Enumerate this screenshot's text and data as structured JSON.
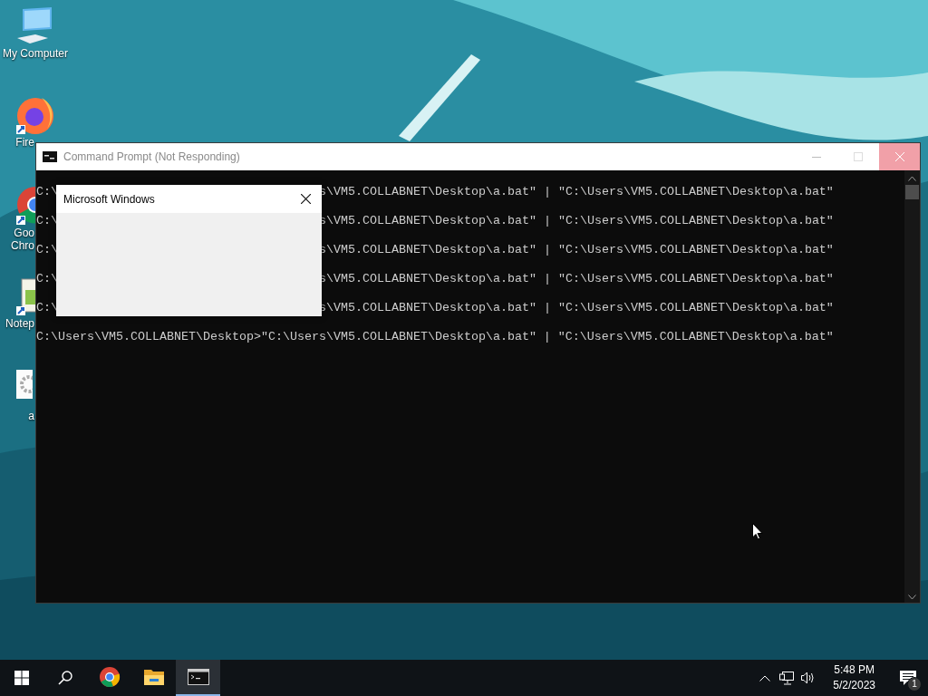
{
  "desktop": {
    "icons": [
      {
        "kind": "computer",
        "lines": [
          "My Computer"
        ]
      },
      {
        "kind": "firefox",
        "lines": [
          "Fire"
        ]
      },
      {
        "kind": "chrome",
        "lines": [
          "Goo",
          "Chro"
        ]
      },
      {
        "kind": "notepad",
        "lines": [
          "Notep"
        ]
      },
      {
        "kind": "gearfile",
        "lines": [
          "a"
        ]
      }
    ]
  },
  "window": {
    "title": "Command Prompt (Not Responding)",
    "responding": false,
    "lines": [
      {
        "left": "C:\\",
        "right": "s\\VM5.COLLABNET\\Desktop\\a.bat\" | \"C:\\Users\\VM5.COLLABNET\\Desktop\\a.bat\""
      },
      {
        "left": "C:\\",
        "right": "s\\VM5.COLLABNET\\Desktop\\a.bat\" | \"C:\\Users\\VM5.COLLABNET\\Desktop\\a.bat\""
      },
      {
        "left": "C:\\",
        "right": "s\\VM5.COLLABNET\\Desktop\\a.bat\" | \"C:\\Users\\VM5.COLLABNET\\Desktop\\a.bat\""
      },
      {
        "left": "C:\\",
        "right": "s\\VM5.COLLABNET\\Desktop\\a.bat\" | \"C:\\Users\\VM5.COLLABNET\\Desktop\\a.bat\""
      },
      {
        "left": "C:\\",
        "right": "s\\VM5.COLLABNET\\Desktop\\a.bat\" | \"C:\\Users\\VM5.COLLABNET\\Desktop\\a.bat\""
      },
      {
        "text": "C:\\Users\\VM5.COLLABNET\\Desktop>\"C:\\Users\\VM5.COLLABNET\\Desktop\\a.bat\" | \"C:\\Users\\VM5.COLLABNET\\Desktop\\a.bat\""
      }
    ]
  },
  "dialog": {
    "title": "Microsoft Windows"
  },
  "taskbar": {
    "apps": [
      {
        "kind": "chrome",
        "selected": false
      },
      {
        "kind": "explorer",
        "selected": false
      },
      {
        "kind": "terminal",
        "selected": true
      }
    ],
    "clock": {
      "time": "5:48 PM",
      "date": "5/2/2023"
    },
    "notification_count": "1"
  }
}
